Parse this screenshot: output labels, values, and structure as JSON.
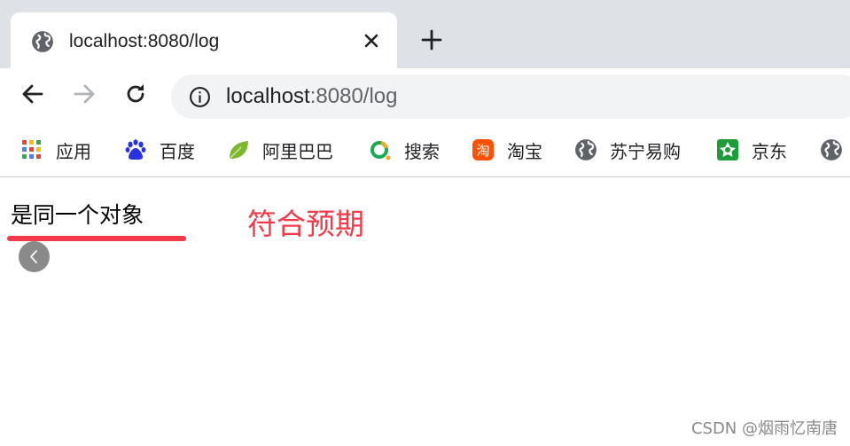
{
  "tab": {
    "title": "localhost:8080/log",
    "favicon": "globe-icon"
  },
  "toolbar": {
    "url_host": "localhost",
    "url_rest": ":8080/log"
  },
  "bookmarks": [
    {
      "label": "应用",
      "icon": "apps-grid-icon"
    },
    {
      "label": "百度",
      "icon": "baidu-paw-icon"
    },
    {
      "label": "阿里巴巴",
      "icon": "alibaba-leaf-icon"
    },
    {
      "label": "搜索",
      "icon": "search-ring-icon"
    },
    {
      "label": "淘宝",
      "icon": "taobao-icon"
    },
    {
      "label": "苏宁易购",
      "icon": "globe-icon"
    },
    {
      "label": "京东",
      "icon": "jd-icon"
    }
  ],
  "content": {
    "text": "是同一个对象",
    "annotation": "符合预期"
  },
  "watermark": "CSDN @烟雨忆南唐",
  "colors": {
    "accent_red": "#f23a48",
    "tabstrip": "#dee1e6",
    "omnibox": "#f1f3f4"
  }
}
